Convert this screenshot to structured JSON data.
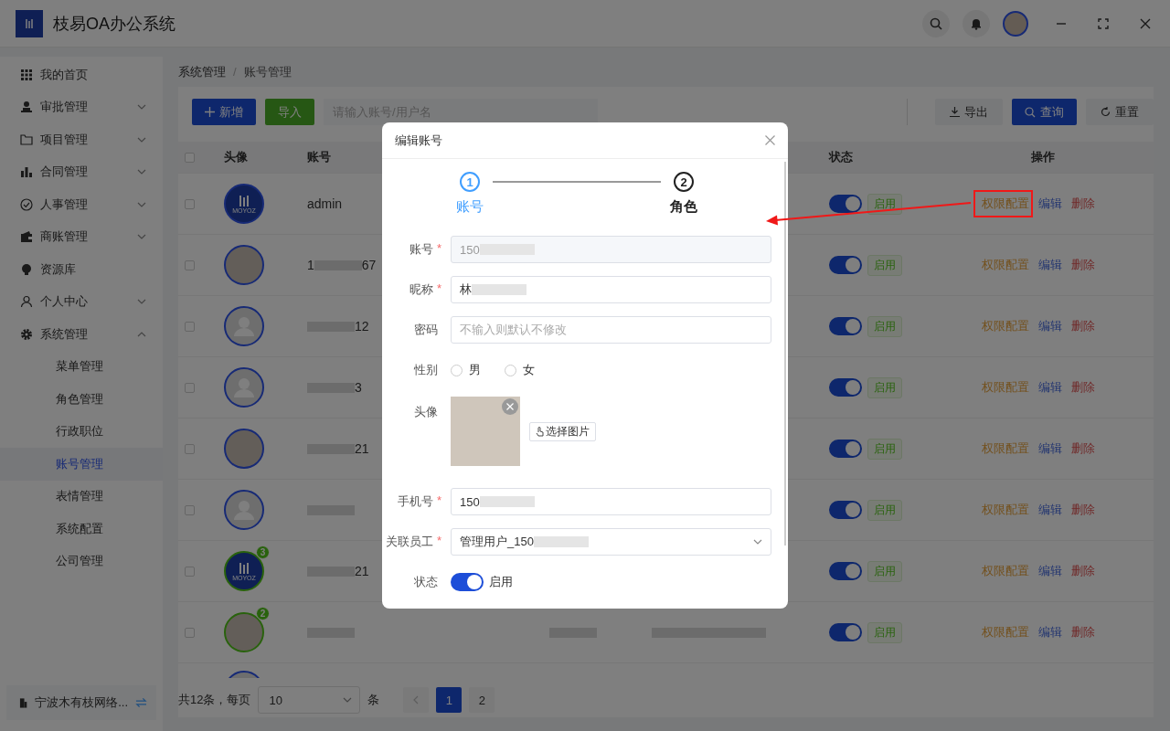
{
  "app": {
    "title": "枝易OA办公系统"
  },
  "sidebar": {
    "items": [
      {
        "label": "我的首页"
      },
      {
        "label": "审批管理",
        "expanded": false
      },
      {
        "label": "项目管理",
        "expanded": false
      },
      {
        "label": "合同管理",
        "expanded": false
      },
      {
        "label": "人事管理",
        "expanded": false
      },
      {
        "label": "商账管理",
        "expanded": false
      },
      {
        "label": "资源库"
      },
      {
        "label": "个人中心",
        "expanded": false
      },
      {
        "label": "系统管理",
        "expanded": true,
        "children": [
          {
            "label": "菜单管理",
            "selected": false
          },
          {
            "label": "角色管理",
            "selected": false
          },
          {
            "label": "行政职位",
            "selected": false
          },
          {
            "label": "账号管理",
            "selected": true
          },
          {
            "label": "表情管理",
            "selected": false
          },
          {
            "label": "系统配置",
            "selected": false
          },
          {
            "label": "公司管理",
            "selected": false
          }
        ]
      }
    ],
    "company": "宁波木有枝网络..."
  },
  "breadcrumb": {
    "items": [
      "系统管理",
      "账号管理"
    ],
    "separator": "/"
  },
  "toolbar": {
    "add": "新增",
    "import": "导入",
    "search_placeholder": "请输入账号/用户名",
    "export": "导出",
    "query": "查询",
    "reset": "重置"
  },
  "table": {
    "columns": [
      "头像",
      "账号",
      "状态",
      "操作"
    ],
    "rows": [
      {
        "checked": false,
        "avatar": {
          "kind": "logo",
          "logo_text": "MOYOZ"
        },
        "account_start": "admin",
        "redacted": false,
        "status_on": true,
        "status_tag": "启用",
        "highlight": true,
        "actions": [
          {
            "kind": "permission",
            "label": "权限配置"
          },
          {
            "kind": "edit",
            "label": "编辑"
          },
          {
            "kind": "delete",
            "label": "删除"
          }
        ]
      },
      {
        "checked": false,
        "avatar": {
          "kind": "photo"
        },
        "account_start": "1",
        "account_end": "67",
        "redacted": true,
        "status_on": true,
        "status_tag": "启用",
        "actions": [
          {
            "kind": "permission",
            "label": "权限配置"
          },
          {
            "kind": "edit",
            "label": "编辑"
          },
          {
            "kind": "delete",
            "label": "删除"
          }
        ]
      },
      {
        "checked": false,
        "avatar": {
          "kind": "default"
        },
        "account_end": "12",
        "redacted": true,
        "status_on": true,
        "status_tag": "启用",
        "actions": [
          {
            "kind": "permission",
            "label": "权限配置"
          },
          {
            "kind": "edit",
            "label": "编辑"
          },
          {
            "kind": "delete",
            "label": "删除"
          }
        ]
      },
      {
        "checked": false,
        "avatar": {
          "kind": "default"
        },
        "account_end": "3",
        "redacted": true,
        "status_on": true,
        "status_tag": "启用",
        "actions": [
          {
            "kind": "permission",
            "label": "权限配置"
          },
          {
            "kind": "edit",
            "label": "编辑"
          },
          {
            "kind": "delete",
            "label": "删除"
          }
        ]
      },
      {
        "checked": false,
        "avatar": {
          "kind": "photo"
        },
        "account_end": "21",
        "redacted": true,
        "status_on": true,
        "status_tag": "启用",
        "actions": [
          {
            "kind": "permission",
            "label": "权限配置"
          },
          {
            "kind": "edit",
            "label": "编辑"
          },
          {
            "kind": "delete",
            "label": "删除"
          }
        ]
      },
      {
        "checked": false,
        "avatar": {
          "kind": "default"
        },
        "redacted": true,
        "status_on": true,
        "status_tag": "启用",
        "actions": [
          {
            "kind": "permission",
            "label": "权限配置"
          },
          {
            "kind": "edit",
            "label": "编辑"
          },
          {
            "kind": "delete",
            "label": "删除"
          }
        ]
      },
      {
        "checked": false,
        "avatar": {
          "kind": "logo",
          "logo_text": "MOYOZ",
          "badge": "3"
        },
        "account_end": "21",
        "redacted": true,
        "status_on": true,
        "status_tag": "启用",
        "actions": [
          {
            "kind": "permission",
            "label": "权限配置"
          },
          {
            "kind": "edit",
            "label": "编辑"
          },
          {
            "kind": "delete",
            "label": "删除"
          }
        ]
      },
      {
        "checked": false,
        "avatar": {
          "kind": "photo",
          "badge": "2"
        },
        "redacted": true,
        "other_cells_redacted": true,
        "status_on": true,
        "status_tag": "启用",
        "actions": [
          {
            "kind": "permission",
            "label": "权限配置"
          },
          {
            "kind": "edit",
            "label": "编辑"
          },
          {
            "kind": "delete",
            "label": "删除"
          }
        ]
      },
      {
        "avatar": {
          "kind": "default"
        }
      }
    ],
    "select_all": false
  },
  "pagination": {
    "total": "共12条，每页",
    "page_size": "10",
    "unit": "条",
    "pages": [
      {
        "label": "1",
        "selected": true
      },
      {
        "label": "2",
        "selected": false
      }
    ]
  },
  "modal": {
    "title": "编辑账号",
    "steps": [
      {
        "number": "1",
        "label": "账号",
        "selected": true
      },
      {
        "number": "2",
        "label": "角色",
        "selected": false
      }
    ],
    "fields": [
      {
        "kind": "input",
        "label": "账号",
        "required_mark": "*",
        "value": "150",
        "redacted": true,
        "disabled": true
      },
      {
        "kind": "input",
        "label": "昵称",
        "required_mark": "*",
        "value": "林",
        "redacted": true,
        "disabled": false
      },
      {
        "kind": "input",
        "label": "密码",
        "placeholder": "不输入则默认不修改"
      },
      {
        "kind": "radio",
        "label": "性别",
        "options": [
          {
            "label": "男",
            "selected": false
          },
          {
            "label": "女",
            "selected": false
          }
        ]
      },
      {
        "kind": "image",
        "label": "头像",
        "button": "选择图片"
      },
      {
        "kind": "input",
        "label": "手机号",
        "required_mark": "*",
        "value": "150",
        "redacted": true,
        "disabled": false
      },
      {
        "kind": "select",
        "label": "关联员工",
        "required_mark": "*",
        "value": "管理用户_150",
        "redacted": true
      },
      {
        "kind": "switch",
        "label": "状态",
        "on": true,
        "text": "启用"
      }
    ]
  }
}
